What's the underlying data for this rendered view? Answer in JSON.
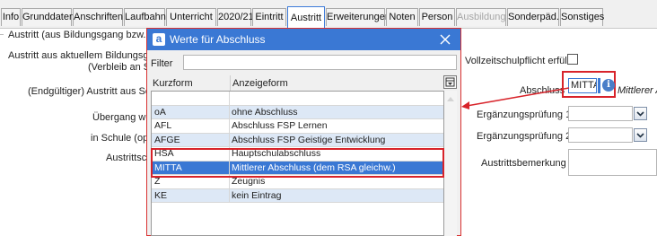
{
  "tabs": [
    {
      "label": "Info",
      "active": false,
      "disabled": false
    },
    {
      "label": "Grunddaten",
      "active": false,
      "disabled": false
    },
    {
      "label": "Anschriften",
      "active": false,
      "disabled": false
    },
    {
      "label": "Laufbahn",
      "active": false,
      "disabled": false
    },
    {
      "label": "Unterricht",
      "active": false,
      "disabled": false
    },
    {
      "label": "2020/21",
      "active": false,
      "disabled": false
    },
    {
      "label": "Eintritt",
      "active": false,
      "disabled": false
    },
    {
      "label": "Austritt",
      "active": true,
      "disabled": false
    },
    {
      "label": "Erweiterungen",
      "active": false,
      "disabled": false
    },
    {
      "label": "Noten",
      "active": false,
      "disabled": false
    },
    {
      "label": "Person",
      "active": false,
      "disabled": false
    },
    {
      "label": "Ausbildung",
      "active": false,
      "disabled": true
    },
    {
      "label": "Sonderpäd.",
      "active": false,
      "disabled": false
    },
    {
      "label": "Sonstiges",
      "active": false,
      "disabled": false
    }
  ],
  "form": {
    "section_title": "Austritt (aus Bildungsgang bzw. Sc",
    "austritt_bildungsgang_line1": "Austritt aus aktuellem Bildungsgang",
    "austritt_bildungsgang_line2": "(Verbleib an Sc",
    "endgueltiger_austritt": "(Endgültiger) Austritt aus Schul",
    "uebergang": "Übergang w",
    "in_schule": "in Schule (opti",
    "austrittsschule": "Austrittsc",
    "vollzeitschulpflicht_label": "Vollzeitschulpflicht erfüllt",
    "abschluss_label": "Abschluss",
    "abschluss_value": "MITTA",
    "abschluss_description": "Mittlerer Ab",
    "ergaenzung1_label": "Ergänzungsprüfung 1",
    "ergaenzung2_label": "Ergänzungsprüfung 2",
    "austrittsbemerkung_label": "Austrittsbemerkung"
  },
  "dialog": {
    "title": "Werte für Abschluss",
    "logo_letter": "a",
    "filter_label": "Filter",
    "filter_value": "",
    "col_kurzform": "Kurzform",
    "col_anzeigeform": "Anzeigeform",
    "rows": [
      {
        "kurz": "",
        "anzeige": ""
      },
      {
        "kurz": "oA",
        "anzeige": "ohne Abschluss"
      },
      {
        "kurz": "AFL",
        "anzeige": "Abschluss FSP Lernen"
      },
      {
        "kurz": "AFGE",
        "anzeige": "Abschluss FSP Geistige Entwicklung"
      },
      {
        "kurz": "HSA",
        "anzeige": "Hauptschulabschluss"
      },
      {
        "kurz": "MITTA",
        "anzeige": "Mittlerer Abschluss (dem RSA gleichw.)"
      },
      {
        "kurz": "Z",
        "anzeige": "Zeugnis"
      },
      {
        "kurz": "KE",
        "anzeige": "kein Eintrag"
      }
    ],
    "selected_row": 5
  },
  "colors": {
    "titlebar": "#3a78d4",
    "selection": "#3a78d4",
    "row_alt": "#dde8f6",
    "annotation_red": "#d8232a"
  }
}
